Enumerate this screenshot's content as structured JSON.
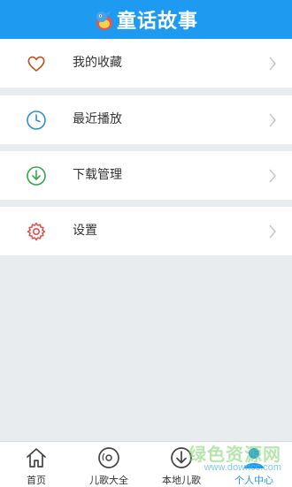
{
  "header": {
    "title": "童话故事",
    "logo_icon": "cartoon-dragon-logo",
    "bg_color": "#1e9af0"
  },
  "menu": {
    "items": [
      {
        "label": "我的收藏",
        "icon": "heart-icon",
        "color": "#b9561f"
      },
      {
        "label": "最近播放",
        "icon": "clock-icon",
        "color": "#2f8fd3"
      },
      {
        "label": "下载管理",
        "icon": "download-icon",
        "color": "#3aa64a"
      },
      {
        "label": "设置",
        "icon": "gear-icon",
        "color": "#d9534f"
      }
    ]
  },
  "tabbar": {
    "tabs": [
      {
        "label": "首页",
        "icon": "home-icon",
        "active": false
      },
      {
        "label": "儿歌大全",
        "icon": "disc-icon",
        "active": false
      },
      {
        "label": "本地儿歌",
        "icon": "download-circle-icon",
        "active": false
      },
      {
        "label": "个人中心",
        "icon": "person-icon",
        "active": true
      }
    ],
    "active_color": "#1e9af0"
  },
  "watermark": {
    "main": "绿色资源网",
    "sub": "www.downcc.com"
  }
}
